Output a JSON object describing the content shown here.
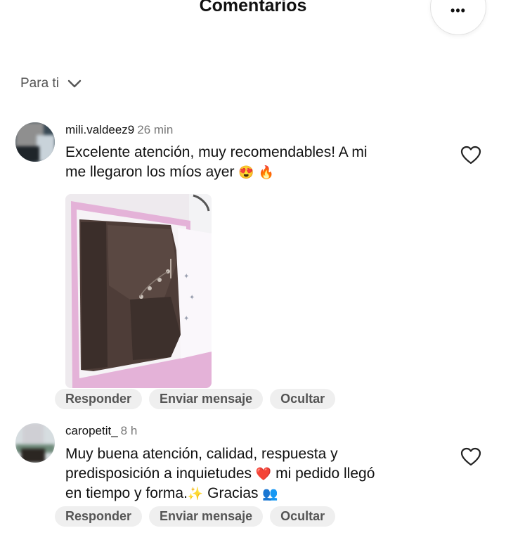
{
  "header": {
    "title": "Comentarios",
    "more_label": "•••"
  },
  "filter": {
    "label": "Para ti"
  },
  "comments": [
    {
      "username": "mili.valdeez9",
      "time": "26 min",
      "line1": "Excelente atención, muy recomendables! A mi",
      "line2": "me llegaron los míos ayer",
      "emojis": [
        "😍",
        "🔥"
      ],
      "has_photo": true
    },
    {
      "username": "caropetit_",
      "time": "8 h",
      "line1": "Muy buena atención, calidad, respuesta y",
      "line2a": "predisposición a inquietudes",
      "emoji_heart": "❤️",
      "line2b": "mi pedido llegó",
      "line3a": "en tiempo y forma.",
      "emoji_sparkles": "✨",
      "line3b": "Gracias",
      "emoji_people": "👥"
    }
  ],
  "actions": {
    "reply": "Responder",
    "send": "Enviar mensaje",
    "hide": "Ocultar"
  },
  "colors": {
    "text": "#111111",
    "secondary": "#777777",
    "pill_bg": "#efefef",
    "pill_text": "#555555"
  }
}
